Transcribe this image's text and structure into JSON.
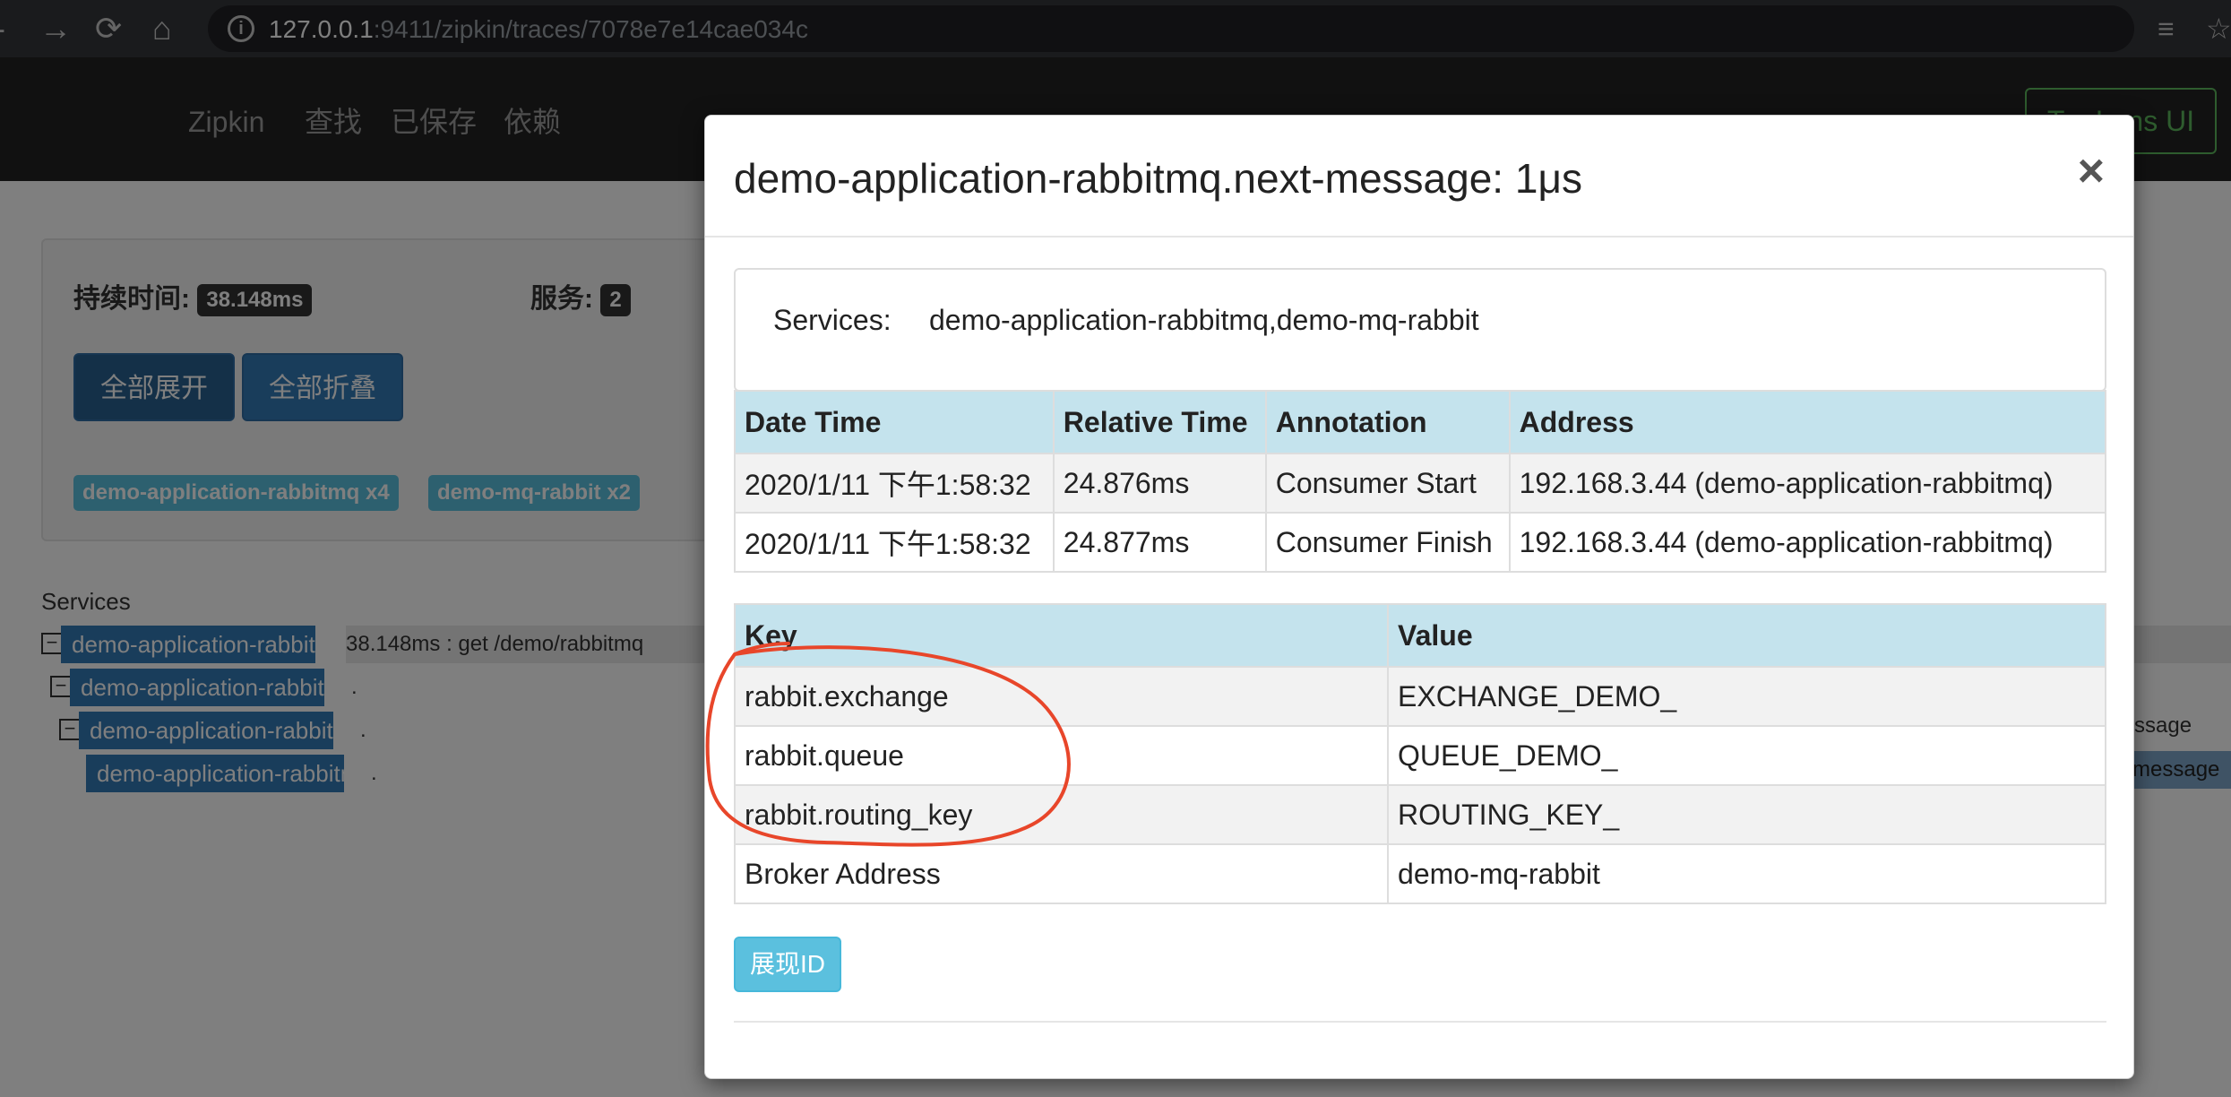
{
  "browser": {
    "back_icon": "arrow-left-icon",
    "forward_icon": "arrow-right-icon",
    "reload_icon": "reload-icon",
    "home_icon": "home-icon",
    "url_host": "127.0.0.1",
    "url_rest": ":9411/zipkin/traces/7078e7e14cae034c"
  },
  "app": {
    "brand": "Zipkin",
    "nav": [
      "查找",
      "已保存",
      "依赖"
    ],
    "lens_button": "Try Lens UI"
  },
  "summary": {
    "duration_label": "持续时间:",
    "duration_value": "38.148ms",
    "services_label": "服务:",
    "services_value": "2",
    "expand_all": "全部展开",
    "collapse_all": "全部折叠",
    "service_tags": [
      "demo-application-rabbitmq x4",
      "demo-mq-rabbit x2"
    ]
  },
  "trace": {
    "services_header": "Services",
    "rows": [
      {
        "label": "demo-application-rabbitmq",
        "duration": "38.148ms : get /demo/rabbitmq"
      },
      {
        "label": "demo-application-rabbitmq",
        "duration": "."
      },
      {
        "label": "demo-application-rabbitmq",
        "duration": "."
      },
      {
        "label": "demo-application-rabbitmq",
        "duration": "."
      }
    ],
    "right_text_1": "ssage",
    "right_text_2": "message"
  },
  "modal": {
    "title": "demo-application-rabbitmq.next-message: 1μs",
    "close": "×",
    "services_label": "Services:",
    "services_value": "demo-application-rabbitmq,demo-mq-rabbit",
    "annotations": {
      "headers": [
        "Date Time",
        "Relative Time",
        "Annotation",
        "Address"
      ],
      "rows": [
        [
          "2020/1/11 下午1:58:32",
          "24.876ms",
          "Consumer Start",
          "192.168.3.44 (demo-application-rabbitmq)"
        ],
        [
          "2020/1/11 下午1:58:32",
          "24.877ms",
          "Consumer Finish",
          "192.168.3.44 (demo-application-rabbitmq)"
        ]
      ]
    },
    "tags": {
      "headers": [
        "Key",
        "Value"
      ],
      "rows": [
        [
          "rabbit.exchange",
          "EXCHANGE_DEMO_"
        ],
        [
          "rabbit.queue",
          "QUEUE_DEMO_"
        ],
        [
          "rabbit.routing_key",
          "ROUTING_KEY_"
        ],
        [
          "Broker Address",
          "demo-mq-rabbit"
        ]
      ]
    },
    "show_id_button": "展现ID"
  },
  "colors": {
    "annotation_circle": "#e8462a",
    "primary": "#337ab7",
    "info": "#5bc0de",
    "table_header": "#c4e3ed"
  }
}
